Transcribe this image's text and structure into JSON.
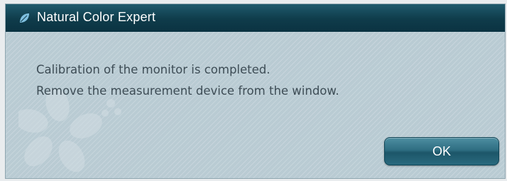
{
  "window": {
    "title": "Natural Color Expert",
    "app_icon": "leaf-icon"
  },
  "message": {
    "line1": "Calibration of the monitor is completed.",
    "line2": "Remove the measurement device from the window."
  },
  "buttons": {
    "ok_label": "OK"
  },
  "colors": {
    "titlebar": "#0f3c4b",
    "dialog_bg": "#b9cbd3",
    "button": "#2f6e82",
    "text": "#3d4c55"
  }
}
